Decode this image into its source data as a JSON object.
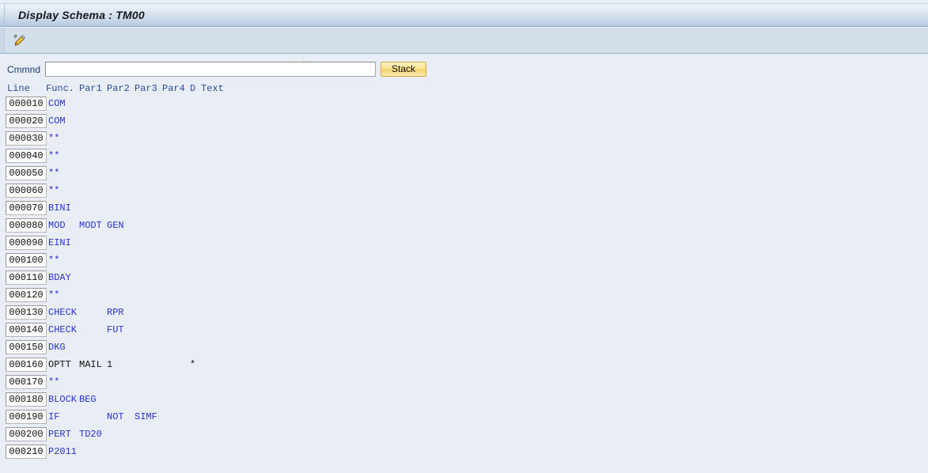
{
  "window": {
    "title": "Display Schema : TM00"
  },
  "toolbar": {
    "edit_icon_name": "pencil-edit-icon",
    "watermark": "© www.tutorialkart.com"
  },
  "command": {
    "label": "Cmmnd",
    "value": "",
    "placeholder": "",
    "stack_label": "Stack"
  },
  "table": {
    "headers": {
      "line": "Line",
      "func": "Func.",
      "par1": "Par1",
      "par2": "Par2",
      "par3": "Par3",
      "par4": "Par4",
      "d": "D",
      "text": "Text"
    },
    "rows": [
      {
        "line": "000010",
        "func": "COM",
        "par1": "",
        "par2": "",
        "par3": "",
        "par4": "",
        "d": "",
        "text": "",
        "style": "blue"
      },
      {
        "line": "000020",
        "func": "COM",
        "par1": "",
        "par2": "",
        "par3": "",
        "par4": "",
        "d": "",
        "text": "",
        "style": "blue"
      },
      {
        "line": "000030",
        "func": "**",
        "par1": "",
        "par2": "",
        "par3": "",
        "par4": "",
        "d": "",
        "text": "",
        "style": "blue"
      },
      {
        "line": "000040",
        "func": "**",
        "par1": "",
        "par2": "",
        "par3": "",
        "par4": "",
        "d": "",
        "text": "",
        "style": "blue"
      },
      {
        "line": "000050",
        "func": "**",
        "par1": "",
        "par2": "",
        "par3": "",
        "par4": "",
        "d": "",
        "text": "",
        "style": "blue"
      },
      {
        "line": "000060",
        "func": "**",
        "par1": "",
        "par2": "",
        "par3": "",
        "par4": "",
        "d": "",
        "text": "",
        "style": "blue"
      },
      {
        "line": "000070",
        "func": "BINI",
        "par1": "",
        "par2": "",
        "par3": "",
        "par4": "",
        "d": "",
        "text": "",
        "style": "blue"
      },
      {
        "line": "000080",
        "func": "MOD",
        "par1": "MODT",
        "par2": "GEN",
        "par3": "",
        "par4": "",
        "d": "",
        "text": "",
        "style": "blue"
      },
      {
        "line": "000090",
        "func": "EINI",
        "par1": "",
        "par2": "",
        "par3": "",
        "par4": "",
        "d": "",
        "text": "",
        "style": "blue"
      },
      {
        "line": "000100",
        "func": "**",
        "par1": "",
        "par2": "",
        "par3": "",
        "par4": "",
        "d": "",
        "text": "",
        "style": "blue"
      },
      {
        "line": "000110",
        "func": "BDAY",
        "par1": "",
        "par2": "",
        "par3": "",
        "par4": "",
        "d": "",
        "text": "",
        "style": "blue"
      },
      {
        "line": "000120",
        "func": "**",
        "par1": "",
        "par2": "",
        "par3": "",
        "par4": "",
        "d": "",
        "text": "",
        "style": "blue"
      },
      {
        "line": "000130",
        "func": "CHECK",
        "par1": "",
        "par2": "RPR",
        "par3": "",
        "par4": "",
        "d": "",
        "text": "",
        "style": "blue"
      },
      {
        "line": "000140",
        "func": "CHECK",
        "par1": "",
        "par2": "FUT",
        "par3": "",
        "par4": "",
        "d": "",
        "text": "",
        "style": "blue"
      },
      {
        "line": "000150",
        "func": "DKG",
        "par1": "",
        "par2": "",
        "par3": "",
        "par4": "",
        "d": "",
        "text": "",
        "style": "blue"
      },
      {
        "line": "000160",
        "func": "OPTT",
        "par1": "MAIL",
        "par2": "1",
        "par3": "",
        "par4": "",
        "d": "*",
        "text": "",
        "style": "black"
      },
      {
        "line": "000170",
        "func": "**",
        "par1": "",
        "par2": "",
        "par3": "",
        "par4": "",
        "d": "",
        "text": "",
        "style": "blue"
      },
      {
        "line": "000180",
        "func": "BLOCK",
        "par1": "BEG",
        "par2": "",
        "par3": "",
        "par4": "",
        "d": "",
        "text": "",
        "style": "blue"
      },
      {
        "line": "000190",
        "func": "IF",
        "par1": "",
        "par2": "NOT",
        "par3": "SIMF",
        "par4": "",
        "d": "",
        "text": "",
        "style": "blue"
      },
      {
        "line": "000200",
        "func": "PERT",
        "par1": "TD20",
        "par2": "",
        "par3": "",
        "par4": "",
        "d": "",
        "text": "",
        "style": "blue"
      },
      {
        "line": "000210",
        "func": "P2011",
        "par1": "",
        "par2": "",
        "par3": "",
        "par4": "",
        "d": "",
        "text": "",
        "style": "blue"
      }
    ]
  },
  "colors": {
    "title_bar_top": "#eef3fa",
    "title_bar_bottom": "#a8bcd6",
    "toolbar_bg": "#d3dfeb",
    "page_bg": "#e9eef6",
    "row_text_blue": "#2b30d0",
    "row_text_black": "#111111",
    "header_text": "#2b4b9b",
    "watermark": "#e6b684",
    "stack_button": "#f3d271"
  }
}
